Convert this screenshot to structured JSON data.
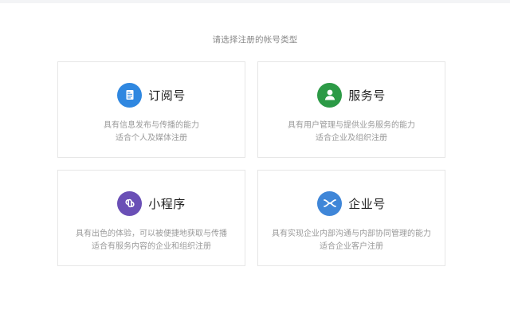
{
  "prompt": "请选择注册的帐号类型",
  "cards": [
    {
      "title": "订阅号",
      "icon": "document-icon",
      "icon_color": "#2f87e0",
      "desc_line1": "具有信息发布与传播的能力",
      "desc_line2": "适合个人及媒体注册"
    },
    {
      "title": "服务号",
      "icon": "user-icon",
      "icon_color": "#2c9a46",
      "desc_line1": "具有用户管理与提供业务服务的能力",
      "desc_line2": "适合企业及组织注册"
    },
    {
      "title": "小程序",
      "icon": "mini-program-icon",
      "icon_color": "#6a4fb6",
      "desc_line1": "具有出色的体验，可以被便捷地获取与传播",
      "desc_line2": "适合有服务内容的企业和组织注册"
    },
    {
      "title": "企业号",
      "icon": "enterprise-icon",
      "icon_color": "#3f86d8",
      "desc_line1": "具有实现企业内部沟通与内部协同管理的能力",
      "desc_line2": "适合企业客户注册"
    }
  ]
}
